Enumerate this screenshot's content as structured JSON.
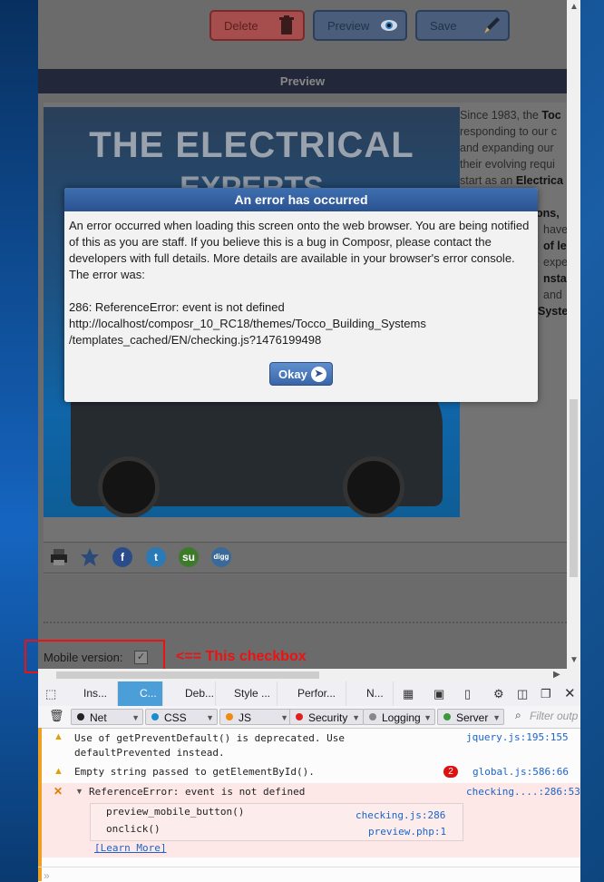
{
  "toolbar": {
    "delete_label": "Delete",
    "preview_label": "Preview",
    "save_label": "Save"
  },
  "preview_header": "Preview",
  "banner": {
    "title_line1": "THE ELECTRICAL",
    "title_line2": "EXPERTS"
  },
  "side_text": {
    "p1": "Since 1983, the ",
    "p1_bold": "Toc",
    "p2": "responding to our c",
    "p3": "and expanding our",
    "p4": "their evolving requi",
    "p5": "start as an ",
    "p5_bold": "Electrica",
    "p6_bold": "ons,",
    "p7": "have",
    "p8_bold": "of le",
    "p9": "expe",
    "p10_bold": "nsta",
    "p11": "and",
    "p12_bold": "Syste"
  },
  "modal": {
    "title": "An error has occurred",
    "message": "An error occurred when loading this screen onto the web browser. You are being notified of this as you are staff. If you believe this is a bug in Composr, please contact the developers with full details. More details are available in your browser's error console. The error was:",
    "error_line": "286: ReferenceError: event is not defined",
    "url_line1": "http://localhost/composr_10_RC18/themes/Tocco_Building_Systems",
    "url_line2": "/templates_cached/EN/checking.js?1476199498",
    "okay_label": "Okay"
  },
  "mobile_label": "Mobile version:",
  "annotation": "<== This checkbox",
  "devtools": {
    "tabs": [
      "Ins...",
      "C...",
      "Deb...",
      "Style ...",
      "Perfor...",
      "N..."
    ],
    "filters": [
      "Net",
      "CSS",
      "JS",
      "Security",
      "Logging",
      "Server"
    ],
    "filter_placeholder": "Filter outp",
    "messages": [
      {
        "text": "Use of getPreventDefault() is deprecated.  Use",
        "text2": "defaultPrevented instead.",
        "loc": "jquery.js:195:155"
      },
      {
        "text": "Empty string passed to getElementById().",
        "badge": "2",
        "loc": "global.js:586:66"
      },
      {
        "text": "ReferenceError: event is not defined",
        "loc": "checking....:286:53",
        "stack": [
          {
            "fn": "preview_mobile_button()",
            "loc": "checking.js:286"
          },
          {
            "fn": "onclick()",
            "loc": "preview.php:1"
          }
        ],
        "learn_more": "[Learn More]"
      }
    ]
  }
}
